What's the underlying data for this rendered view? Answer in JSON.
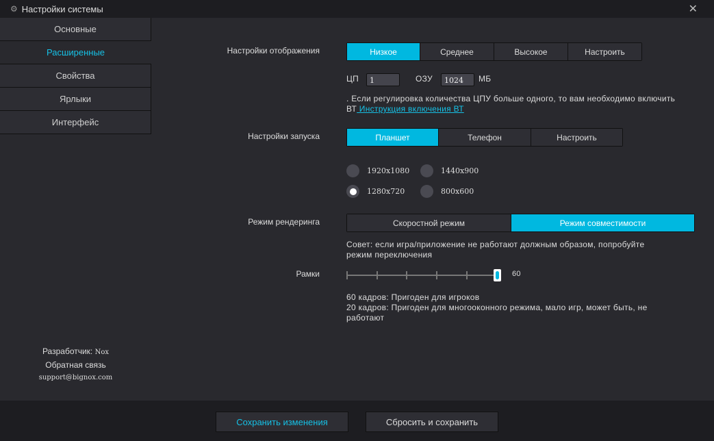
{
  "window": {
    "title": "Настройки системы",
    "close": "✕",
    "gear": "⚙"
  },
  "sidebar": {
    "items": [
      {
        "label": "Основные"
      },
      {
        "label": "Расширенные",
        "active": true
      },
      {
        "label": "Свойства"
      },
      {
        "label": "Ярлыки"
      },
      {
        "label": "Интерфейс"
      }
    ],
    "developer_label": "Разработчик:",
    "developer": "Nox",
    "feedback": "Обратная связь",
    "email": "support@bignox.com"
  },
  "display": {
    "label": "Настройки отображения",
    "options": [
      "Низкое",
      "Среднее",
      "Высокое",
      "Настроить"
    ],
    "selected": 0,
    "cpu_label": "ЦП",
    "cpu_value": "1",
    "ram_label": "ОЗУ",
    "ram_value": "1024",
    "ram_unit": "МБ",
    "note": ". Если регулировка количества ЦПУ больше одного,  то вам необходимо включить ВТ",
    "link": " Инструкция  включения  ВТ"
  },
  "startup": {
    "label": "Настройки запуска",
    "options": [
      "Планшет",
      "Телефон",
      "Настроить"
    ],
    "selected": 0,
    "resolutions": [
      "1920x1080",
      "1440x900",
      "1280x720",
      "800x600"
    ],
    "selected_resolution": "1280x720"
  },
  "render": {
    "label": "Режим рендеринга",
    "options": [
      "Скоростной режим",
      "Режим совместимости"
    ],
    "selected": 1,
    "tip": "Совет:  если игра/приложение не работают должным образом,  попробуйте режим переключения"
  },
  "frames": {
    "label": "Рамки",
    "value": "60",
    "fraction": 1.0,
    "tick_count": 6,
    "info1": "60  кадров:  Пригоден для игроков",
    "info2": "20  кадров:  Пригоден для многооконного режима,  мало игр,  может быть,  не работают"
  },
  "footer": {
    "save": "Сохранить изменения",
    "reset": "Сбросить и сохранить"
  },
  "colors": {
    "accent": "#00b8e0"
  }
}
